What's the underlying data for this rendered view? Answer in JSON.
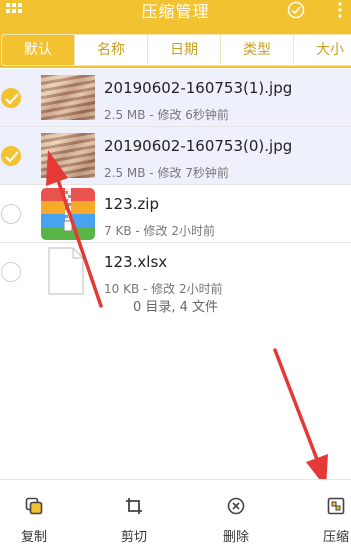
{
  "header": {
    "title": "压缩管理"
  },
  "tabs": [
    "默认",
    "名称",
    "日期",
    "类型",
    "大小"
  ],
  "files": [
    {
      "name": "20190602-160753(1).jpg",
      "meta": "2.5 MB - 修改 6秒钟前",
      "selected": true,
      "icon": "image-thumbnail"
    },
    {
      "name": "20190602-160753(0).jpg",
      "meta": "2.5 MB - 修改 7秒钟前",
      "selected": true,
      "icon": "image-thumbnail"
    },
    {
      "name": "123.zip",
      "meta": "7 KB - 修改 2小时前",
      "selected": false,
      "icon": "zip-archive-icon"
    },
    {
      "name": "123.xlsx",
      "meta": "10 KB - 修改 2小时前",
      "selected": false,
      "icon": "document-icon"
    }
  ],
  "summary": "0 目录, 4 文件",
  "toolbar": {
    "copy": "复制",
    "cut": "剪切",
    "delete": "删除",
    "compress": "压缩"
  },
  "colors": {
    "accent": "#f2c230",
    "selected_row": "#eef1fb",
    "annotation_arrow": "#e53935"
  }
}
